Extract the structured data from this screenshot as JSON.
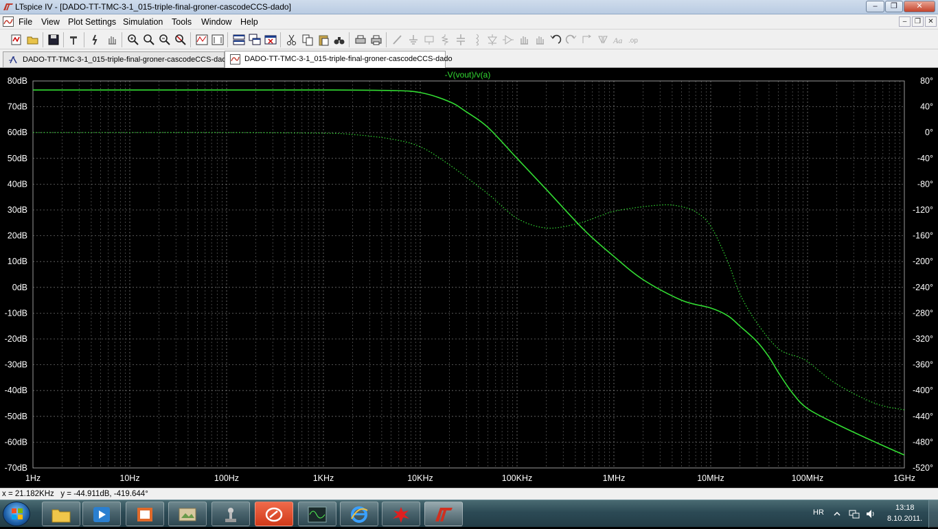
{
  "window": {
    "title": "LTspice IV - [DADO-TT-TMC-3-1_015-triple-final-groner-cascodeCCS-dado]",
    "minimize": "–",
    "maximize": "❐",
    "close": "✕"
  },
  "menu": {
    "items": [
      "File",
      "View",
      "Plot Settings",
      "Simulation",
      "Tools",
      "Window",
      "Help"
    ],
    "doc_minimize": "–",
    "doc_restore": "❐",
    "doc_close": "✕"
  },
  "tabs": [
    {
      "label": "DADO-TT-TMC-3-1_015-triple-final-groner-cascodeCCS-dado",
      "icon": "schematic-icon",
      "active": false
    },
    {
      "label": "DADO-TT-TMC-3-1_015-triple-final-groner-cascodeCCS-dado",
      "icon": "waveform-icon",
      "active": true
    }
  ],
  "status": {
    "readout": "x = 21.182KHz   y = -44.911dB, -419.644°"
  },
  "taskbar": {
    "language": "HR",
    "time": "13:18",
    "date": "8.10.2011."
  },
  "chart_data": {
    "type": "line",
    "title": "-V(vout)/v(a)",
    "x_scale": "log",
    "xlim": [
      1,
      1000000000
    ],
    "x_tick_values": [
      1,
      10,
      100,
      1000,
      10000,
      100000,
      1000000,
      10000000,
      100000000,
      1000000000
    ],
    "x_tick_labels": [
      "1Hz",
      "10Hz",
      "100Hz",
      "1KHz",
      "10KHz",
      "100KHz",
      "1MHz",
      "10MHz",
      "100MHz",
      "1GHz"
    ],
    "y_left": {
      "ylim": [
        -70,
        80
      ],
      "tick_values": [
        80,
        70,
        60,
        50,
        40,
        30,
        20,
        10,
        0,
        -10,
        -20,
        -30,
        -40,
        -50,
        -60,
        -70
      ],
      "tick_labels": [
        "80dB",
        "70dB",
        "60dB",
        "50dB",
        "40dB",
        "30dB",
        "20dB",
        "10dB",
        "0dB",
        "-10dB",
        "-20dB",
        "-30dB",
        "-40dB",
        "-50dB",
        "-60dB",
        "-70dB"
      ]
    },
    "y_right": {
      "ylim": [
        -520,
        80
      ],
      "tick_values": [
        80,
        40,
        0,
        -40,
        -80,
        -120,
        -160,
        -200,
        -240,
        -280,
        -320,
        -360,
        -400,
        -440,
        -480,
        -520
      ],
      "tick_labels": [
        "80°",
        "40°",
        "0°",
        "-40°",
        "-80°",
        "-120°",
        "-160°",
        "-200°",
        "-240°",
        "-280°",
        "-320°",
        "-360°",
        "-400°",
        "-440°",
        "-480°",
        "-520°"
      ]
    },
    "grid": true,
    "colors": {
      "trace": "#33dd33",
      "grid": "#8a8a8a",
      "axis_text": "#ffffff",
      "background": "#000000"
    },
    "series": [
      {
        "quantity": "magnitude",
        "axis": "left",
        "style": "solid",
        "x": [
          1,
          10,
          100,
          1000,
          5000,
          10000,
          20000,
          30000,
          50000,
          100000,
          200000,
          500000,
          1000000,
          2000000,
          5000000,
          10000000,
          15000000,
          20000000,
          30000000,
          40000000,
          50000000,
          70000000,
          100000000,
          200000000,
          500000000,
          1000000000
        ],
        "y": [
          76.5,
          76.5,
          76.5,
          76.5,
          76.3,
          75.5,
          72,
          68,
          62,
          50,
          38,
          22,
          12,
          3,
          -5,
          -8,
          -11,
          -15,
          -21,
          -27,
          -33,
          -41,
          -47,
          -53,
          -60,
          -65
        ]
      },
      {
        "quantity": "phase",
        "axis": "right",
        "style": "dotted",
        "x": [
          1,
          10,
          100,
          1000,
          2000,
          5000,
          10000,
          20000,
          50000,
          100000,
          200000,
          400000,
          700000,
          1000000,
          2000000,
          3500000,
          5000000,
          7000000,
          10000000,
          15000000,
          20000000,
          30000000,
          50000000,
          80000000,
          100000000,
          200000000,
          500000000,
          1000000000
        ],
        "y": [
          0,
          0,
          0,
          -1,
          -3,
          -10,
          -22,
          -50,
          -95,
          -133,
          -148,
          -142,
          -130,
          -122,
          -115,
          -112,
          -115,
          -123,
          -145,
          -200,
          -250,
          -295,
          -335,
          -348,
          -355,
          -390,
          -420,
          -430
        ]
      }
    ]
  }
}
